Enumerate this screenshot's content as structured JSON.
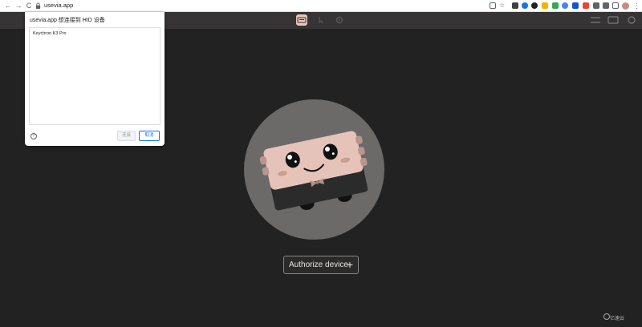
{
  "browser": {
    "url": "usevia.app",
    "back_glyph": "←",
    "forward_glyph": "→",
    "reload_glyph": "C",
    "menu_glyph": "⋮"
  },
  "dialog": {
    "title": "usevia.app 想连接到 HID 设备",
    "devices": [
      "Keychron K3 Pro"
    ],
    "help_glyph": "?",
    "select_label": "连接",
    "cancel_label": "取消"
  },
  "main": {
    "authorize_label": "Authorize device",
    "authorize_plus": "+"
  },
  "colors": {
    "background": "#232222",
    "header": "#363434",
    "accent": "#e9c6bb",
    "circle": "#6b6a69"
  },
  "watermark": "亿速云"
}
